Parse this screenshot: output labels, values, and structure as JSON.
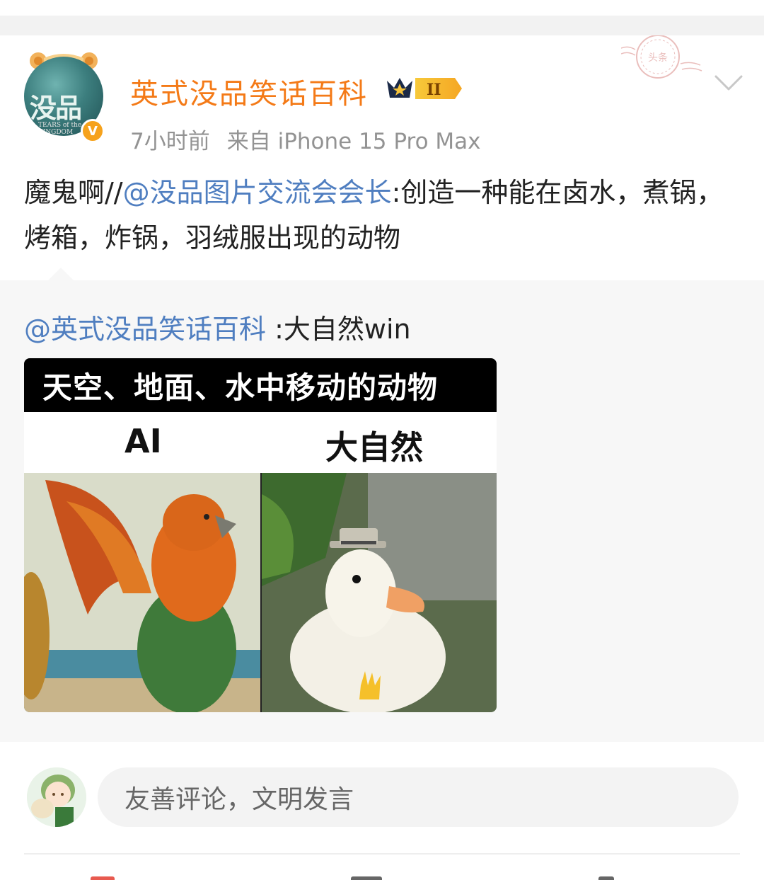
{
  "post": {
    "author": "英式没品笑话百科",
    "time": "7小时前",
    "source": "来自 iPhone 15 Pro Max",
    "level_badge": "II",
    "verified_mark": "V",
    "text_prefix": "魔鬼啊//",
    "text_mention": "@没品图片交流会会长",
    "text_suffix": ":创造一种能在卤水，煮锅，烤箱，炸锅，羽绒服出现的动物",
    "avatar_text": "没品",
    "avatar_subtext": "TEARS of the KINGDOM",
    "stamp_text": "头条"
  },
  "repost": {
    "mention": "@英式没品笑话百科",
    "text": " :大自然win",
    "image": {
      "banner": "天空、地面、水中移动的动物",
      "label_left": "AI",
      "label_right": "大自然"
    }
  },
  "comment": {
    "placeholder": "友善评论，文明发言"
  },
  "colors": {
    "username": "#f47a17",
    "mention": "#4f7ec0",
    "meta": "#939393",
    "page_gap": "#f2f2f2",
    "repost_bg": "#f7f7f7"
  },
  "icons": [
    "verified-badge-icon",
    "crown-level-icon",
    "chevron-down-icon",
    "stamp-icon"
  ]
}
